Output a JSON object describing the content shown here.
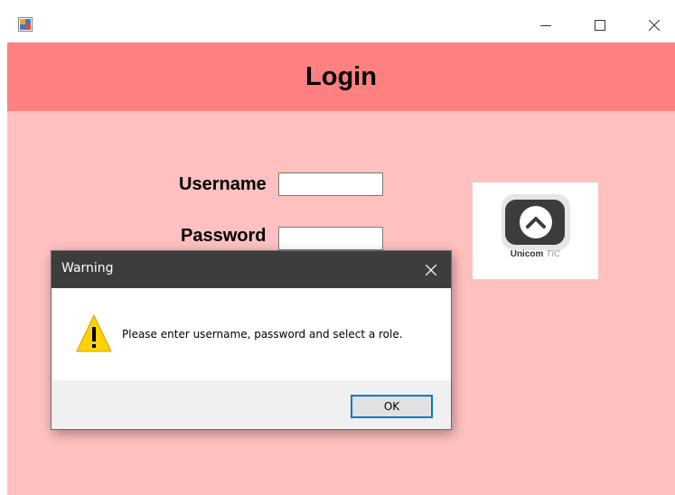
{
  "window": {
    "title": "",
    "icon": "winforms-app-icon"
  },
  "header": {
    "title": "Login",
    "background": "#ff8080"
  },
  "form": {
    "background": "#ffc0c0",
    "username_label": "Username",
    "username_value": "",
    "password_label": "Password",
    "password_value": ""
  },
  "logo": {
    "icon": "unicom-tic-logo",
    "brand": "Unicom",
    "brand_suffix": "TIC"
  },
  "dialog": {
    "title": "Warning",
    "message": "Please enter username, password and select a role.",
    "icon": "warning-icon",
    "ok_label": "OK",
    "accent": "#0078d7"
  }
}
